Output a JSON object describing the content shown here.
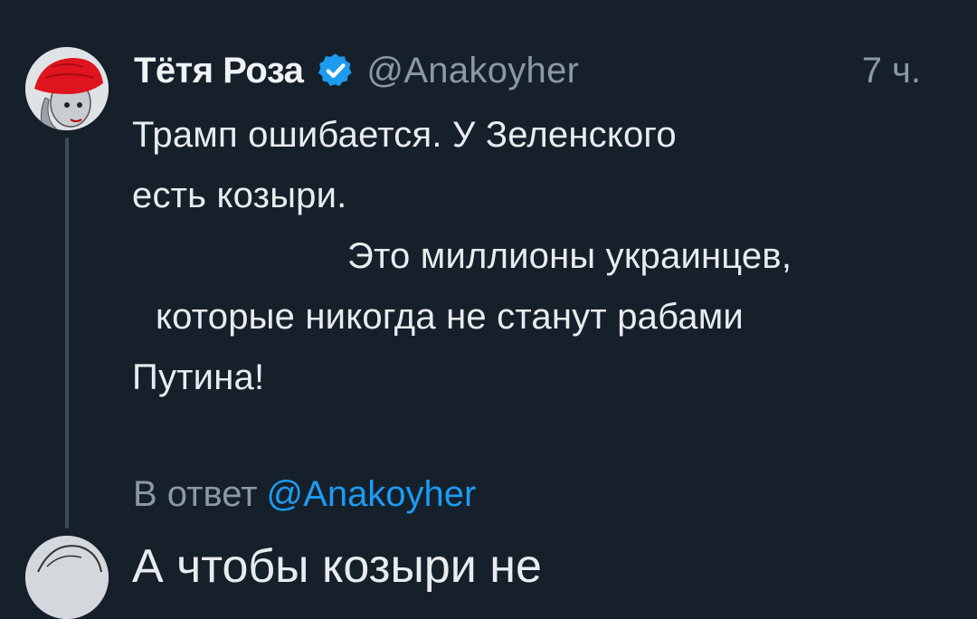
{
  "tweet": {
    "display_name": "Тётя Роза",
    "handle": "@Anakoyher",
    "timestamp": "7 ч.",
    "lines": [
      "Трамп ошибается. У Зеленского",
      "есть козыри.",
      "Это миллионы украинцев,",
      "которые никогда не станут рабами",
      "Путина!"
    ],
    "reply_prefix": "В ответ",
    "reply_handle": "@Anakoyher"
  },
  "next_tweet": {
    "partial_text": "А чтобы козыри не"
  },
  "colors": {
    "background": "#15202b",
    "text": "#e7e9ea",
    "secondary_text": "#8b98a5",
    "link": "#1d9bf0",
    "verified_badge": "#1d9bf0",
    "thread_line": "#3d4a57"
  },
  "icons": {
    "verified": "verified-badge-icon",
    "avatar": "avatar-red-hat-woman"
  }
}
